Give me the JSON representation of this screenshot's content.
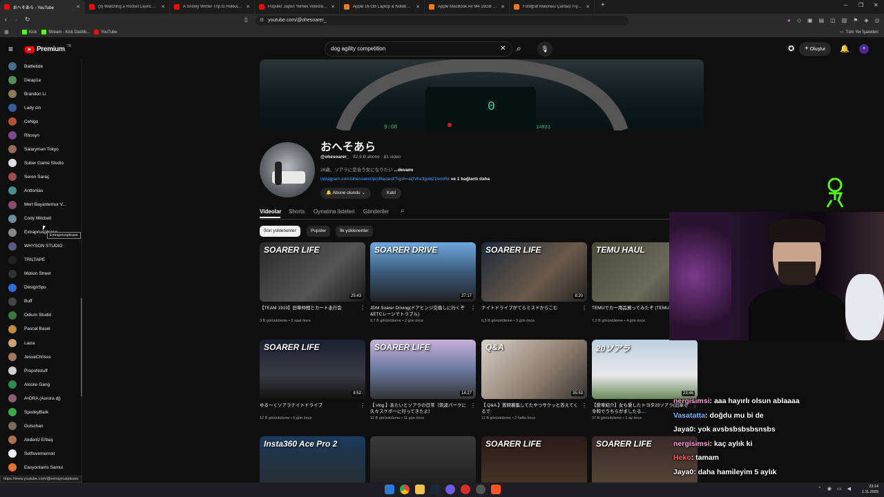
{
  "browser": {
    "tabs": [
      {
        "title": "おへそあら - YouTube",
        "color": "#ff0000"
      },
      {
        "title": "(3) Watching a Rocket Launch at Spa",
        "color": "#ff0000"
      },
      {
        "title": "A Snowy Winter Trip to Hokkaido | 1",
        "color": "#ff0000"
      },
      {
        "title": "Popüler Japon Yemek Videoları Top",
        "color": "#ff0000"
      },
      {
        "title": "Apple 16 GB Laptop & Notebook ve",
        "color": "#f27a1a"
      },
      {
        "title": "Apple MacBook Air M4 16GB 256GB",
        "color": "#f27a1a"
      },
      {
        "title": "Fotoğraf Makinesi Çantası Fiyatları, I",
        "color": "#f27a1a"
      }
    ],
    "url": "youtube.com/@ohesoarer_",
    "bookmarks": [
      "Kick",
      "Stream - Kick Dashb...",
      "YouTube"
    ],
    "all_bookmarks": "Tüm Yer İşaretleri",
    "status_url": "https://www.youtube.com/@extrapriusplease"
  },
  "youtube": {
    "logo": "Premium",
    "logo_region": "TR",
    "search_query": "dog agility competition",
    "create_label": "Oluştur"
  },
  "sidebar": {
    "subscriptions": [
      {
        "name": "Battletide",
        "color": "#4a6d8c"
      },
      {
        "name": "Dieap1e",
        "color": "#5a8c5a"
      },
      {
        "name": "Brandon Li",
        "color": "#8c7a5a"
      },
      {
        "name": "Lady cin",
        "color": "#3b5a9c"
      },
      {
        "name": "CeNgo",
        "color": "#b5502f"
      },
      {
        "name": "Rhosyn",
        "color": "#7a4a8c"
      },
      {
        "name": "Salaryman Tokyo",
        "color": "#9c6a5a"
      },
      {
        "name": "Suber Game Studio",
        "color": "#dddddd"
      },
      {
        "name": "Seren Saraç",
        "color": "#a04a4a"
      },
      {
        "name": "Anttonias",
        "color": "#4a8c8c"
      },
      {
        "name": "Mert Bayantemur V...",
        "color": "#8c4a6d"
      },
      {
        "name": "Cody Mitchell",
        "color": "#6d8ca0"
      },
      {
        "name": "Extrapriusplease",
        "color": "#888888"
      },
      {
        "name": "WHYSON STUDIO",
        "color": "#5a5a8c"
      },
      {
        "name": "TRILTAPE",
        "color": "#222222"
      },
      {
        "name": "Motion Street",
        "color": "#333333"
      },
      {
        "name": "DesignSpo",
        "color": "#2e6fd6"
      },
      {
        "name": "Buff",
        "color": "#444444"
      },
      {
        "name": "Odium Studio",
        "color": "#3a7a3a"
      },
      {
        "name": "Pascal Basel",
        "color": "#c28a3a"
      },
      {
        "name": "Laiza",
        "color": "#d0a070"
      },
      {
        "name": "JesseChrisss",
        "color": "#a07a60"
      },
      {
        "name": "PropsNstuff",
        "color": "#d0d0d0"
      },
      {
        "name": "Aloske Gang",
        "color": "#2a8c4a"
      },
      {
        "name": "A•ORA (Aurora dj)",
        "color": "#8c5a7a"
      },
      {
        "name": "SpookyBark",
        "color": "#3aa84a"
      },
      {
        "name": "Gulschan",
        "color": "#7a6a5a"
      },
      {
        "name": "Akdeniz Erbaş",
        "color": "#b07050"
      },
      {
        "name": "Selflovememoir",
        "color": "#eeeeee"
      },
      {
        "name": "Easyontams Samui",
        "color": "#e07030"
      }
    ],
    "tooltip": "Extrapriusplease"
  },
  "channel": {
    "name": "おへそあら",
    "handle": "@ohesoarer_",
    "subscribers": "82,6 B abone",
    "video_count": "81 video",
    "description": "26歳、ソアラに恋合う女になりたい",
    "more": "...devamı",
    "link": "instagram.com/ohesoarer/profilecard/?igsh=aGVhc3gxb21temRx",
    "link_more": "ve 1 bağlantı daha",
    "subscribed_label": "Abone olundu",
    "join_label": "Katıl",
    "tabs": [
      "Videolar",
      "Shorts",
      "Oynatma listeleri",
      "Gönderiler"
    ],
    "chips": [
      "Son yüklenenler",
      "Popüler",
      "İlk yüklenenler"
    ]
  },
  "videos": [
    {
      "title": "【TEAM 1919】旧車仲間とカート走行会",
      "views": "3 B görüntüleme",
      "age": "9 saat önce",
      "duration": "25:43",
      "thumb_text": "SOARER LIFE"
    },
    {
      "title": "JDM Soarer Driving(ドアヒンジ交換しに行くぞ&ETCレーンでトラブル)",
      "views": "9,7 B görüntüleme",
      "age": "2 gün önce",
      "duration": "27:17",
      "thumb_text": "SOARER DRIVE"
    },
    {
      "title": "ナイトドライブがてらミスドからこむ",
      "views": "6,5 B görüntüleme",
      "age": "3 gün önce",
      "duration": "8:20",
      "thumb_text": "SOARER LIFE"
    },
    {
      "title": "TEMUでカー用品買ってみたぞ (TEMU紹介)",
      "views": "7,3 B görüntüleme",
      "age": "4 gün önce",
      "duration": "",
      "thumb_text": "TEMU HAUL"
    },
    {
      "title": "ゆる〜くソアラナイトドライブ",
      "views": "12 B görüntüleme",
      "age": "5 gün önce",
      "duration": "8:52",
      "thumb_text": "SOARER LIFE"
    },
    {
      "title": "【 vlog 】あたいとソアラの日常（筑波パークに久々スケボーに行ってきたよ）",
      "views": "12 B görüntüleme",
      "age": "11 gün önce",
      "duration": "14:27",
      "thumb_text": "SOARER LIFE"
    },
    {
      "title": "【 Q&A 】質問募集してたやつサクッと答えてくるで",
      "views": "11 B görüntüleme",
      "age": "2 hafta önce",
      "duration": "35:53",
      "thumb_text": "Q&A"
    },
    {
      "title": "【愛車紹介】女も愛したトヨタ20ソアラ(旧車も令和でうちらがましたる…",
      "views": "27 B görüntüleme",
      "age": "1 ay önce",
      "duration": "23:46",
      "thumb_text": "20ソアラ"
    },
    {
      "title": "",
      "views": "",
      "age": "",
      "duration": "",
      "thumb_text": "Insta360 Ace Pro 2"
    },
    {
      "title": "",
      "views": "",
      "age": "",
      "duration": "",
      "thumb_text": ""
    },
    {
      "title": "",
      "views": "",
      "age": "",
      "duration": "",
      "thumb_text": "SOARER LIFE"
    },
    {
      "title": "",
      "views": "",
      "age": "",
      "duration": "",
      "thumb_text": "SOARER LIFE"
    }
  ],
  "chat": [
    {
      "user": "nergisimsi",
      "msg": ": aaa hayırlı olsun ablaaaa",
      "color": "#ff9bd6"
    },
    {
      "user": "Vasatatta",
      "msg": ": doğdu mu bi de",
      "color": "#7fb6ff"
    },
    {
      "user": "Jaya0",
      "msg": ": yok avsbsbsbsbsnsbs",
      "color": "#ffffff"
    },
    {
      "user": "nergisimsi",
      "msg": ": kaç aylık ki",
      "color": "#ff9bd6"
    },
    {
      "user": "Heko",
      "msg": ": tamam",
      "color": "#ff5a5a"
    },
    {
      "user": "Jaya0",
      "msg": ": daha hamileyim 5 aylık",
      "color": "#ffffff"
    }
  ],
  "taskbar": {
    "time": "23:14",
    "date": "1.11.2025"
  }
}
